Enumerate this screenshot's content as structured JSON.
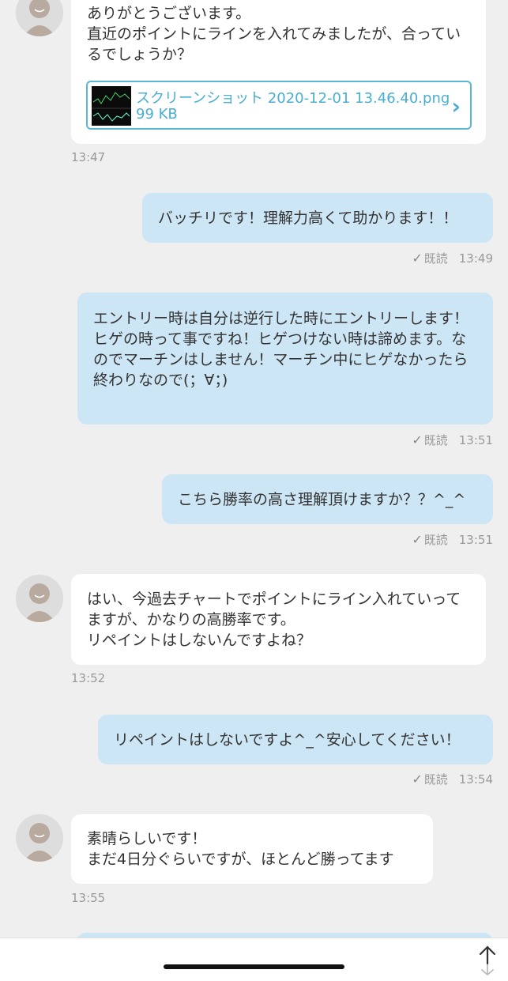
{
  "messages": {
    "m1": {
      "text": "ありがとうございます。\n直近のポイントにラインを入れてみましたが、合っているでしょうか？",
      "attachment": {
        "filename": "スクリーンショット 2020-12-01 13.46.40.png",
        "size": "99 KB"
      },
      "time": "13:47"
    },
    "m2": {
      "text": "バッチリです！理解力高くて助かります！！",
      "read": "既読",
      "time": "13:49"
    },
    "m3": {
      "text": "エントリー時は自分は逆行した時にエントリーします！\nヒゲの時って事ですね！ヒゲつけない時は諦めます。なのでマーチンはしません！マーチン中にヒゲなかったら終わりなので(；∀；)",
      "read": "既読",
      "time": "13:51"
    },
    "m4": {
      "text": "こちら勝率の高さ理解頂けますか？？^_^",
      "read": "既読",
      "time": "13:51"
    },
    "m5": {
      "text": "はい、今過去チャートでポイントにライン入れていってますが、かなりの高勝率です。\nリペイントはしないんですよね？",
      "time": "13:52"
    },
    "m6": {
      "text": "リペイントはしないですよ^_^安心してください！",
      "read": "既読",
      "time": "13:54"
    },
    "m7": {
      "text": "素晴らしいです！\nまだ4日分ぐらいですが、ほとんど勝ってます",
      "time": "13:55"
    }
  },
  "icons": {
    "avatar": "default-user-avatar",
    "check": "check-icon",
    "chevron": "chevron-right-icon",
    "scroll": "scroll-arrows-icon"
  },
  "colors": {
    "background": "#efefef",
    "outgoing": "#cde6f5",
    "incoming": "#ffffff",
    "accent": "#4aaed0"
  }
}
